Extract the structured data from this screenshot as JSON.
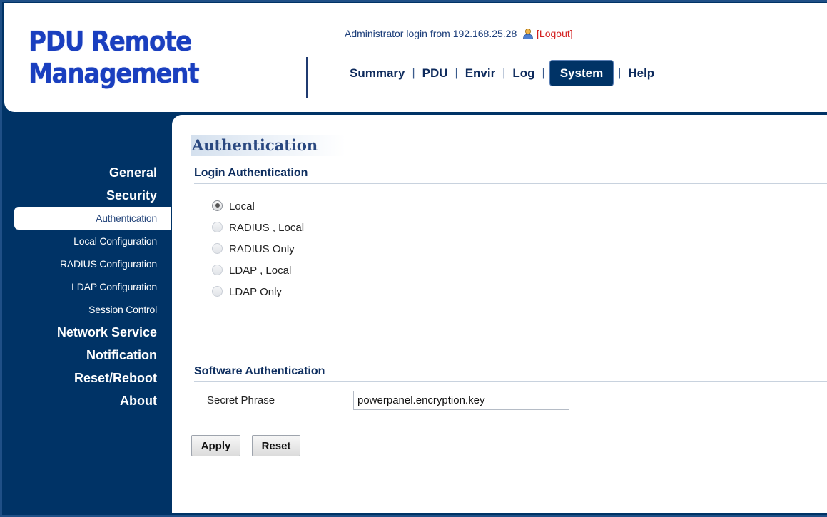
{
  "brand": {
    "line1": "PDU Remote",
    "line2": "Management"
  },
  "login": {
    "text": "Administrator login from 192.168.25.28",
    "logout": "[Logout]"
  },
  "nav": {
    "items": [
      "Summary",
      "PDU",
      "Envir",
      "Log",
      "System",
      "Help"
    ],
    "active": "System"
  },
  "sidebar": {
    "general": "General",
    "security": "Security",
    "sub": [
      "Authentication",
      "Local Configuration",
      "RADIUS Configuration",
      "LDAP Configuration",
      "Session Control"
    ],
    "active_sub": "Authentication",
    "network_service": "Network Service",
    "notification": "Notification",
    "reset_reboot": "Reset/Reboot",
    "about": "About"
  },
  "page": {
    "title": "Authentication",
    "login_auth": {
      "heading": "Login Authentication",
      "options": [
        "Local",
        "RADIUS , Local",
        "RADIUS Only",
        "LDAP , Local",
        "LDAP Only"
      ],
      "selected": "Local"
    },
    "software_auth": {
      "heading": "Software Authentication",
      "secret_label": "Secret Phrase",
      "secret_value": "powerpanel.encryption.key"
    },
    "buttons": {
      "apply": "Apply",
      "reset": "Reset"
    }
  },
  "colors": {
    "sidebar_bg": "#003366",
    "brand": "#1a3fbf",
    "logout": "#d32020"
  },
  "icons": {
    "login_user": "user-icon"
  }
}
